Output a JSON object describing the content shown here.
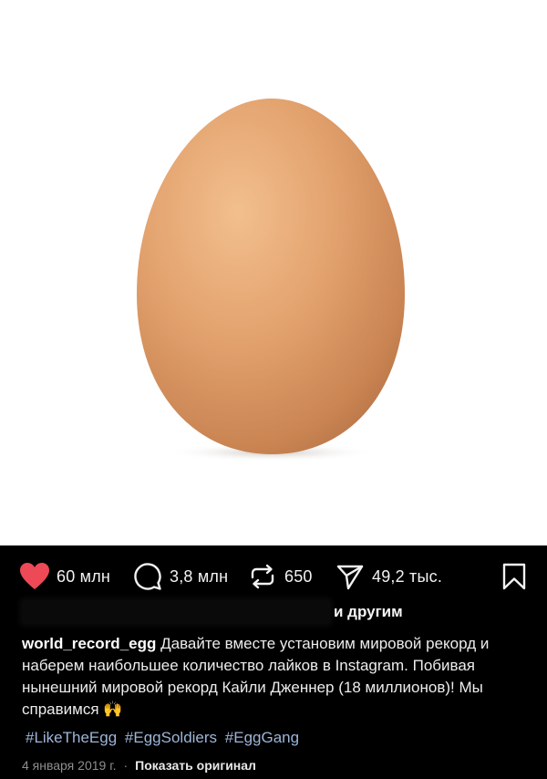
{
  "actions": {
    "likes": "60 млн",
    "comments": "3,8 млн",
    "reposts": "650",
    "shares": "49,2 тыс.",
    "like_color": "#ed4956"
  },
  "liked_by": {
    "others_text": "и другим"
  },
  "caption": {
    "username": "world_record_egg",
    "text": "Давайте вместе установим мировой рекорд и наберем наибольшее количество лайков в Instagram. Побивая нынешний мировой рекорд Кайли Дженнер (18 миллионов)! Мы справимся 🙌"
  },
  "hashtags": [
    "#LikeTheEgg",
    "#EggSoldiers",
    "#EggGang"
  ],
  "meta": {
    "date": "4 января 2019 г.",
    "separator": "·",
    "translate_label": "Показать оригинал"
  },
  "icons": {
    "like": "heart-filled-icon",
    "comment": "comment-bubble-icon",
    "repost": "repost-arrows-icon",
    "share": "paper-plane-icon",
    "save": "bookmark-icon"
  },
  "colors": {
    "background": "#000000",
    "egg": "#e3a36f",
    "hashtag": "#9db5d8"
  }
}
